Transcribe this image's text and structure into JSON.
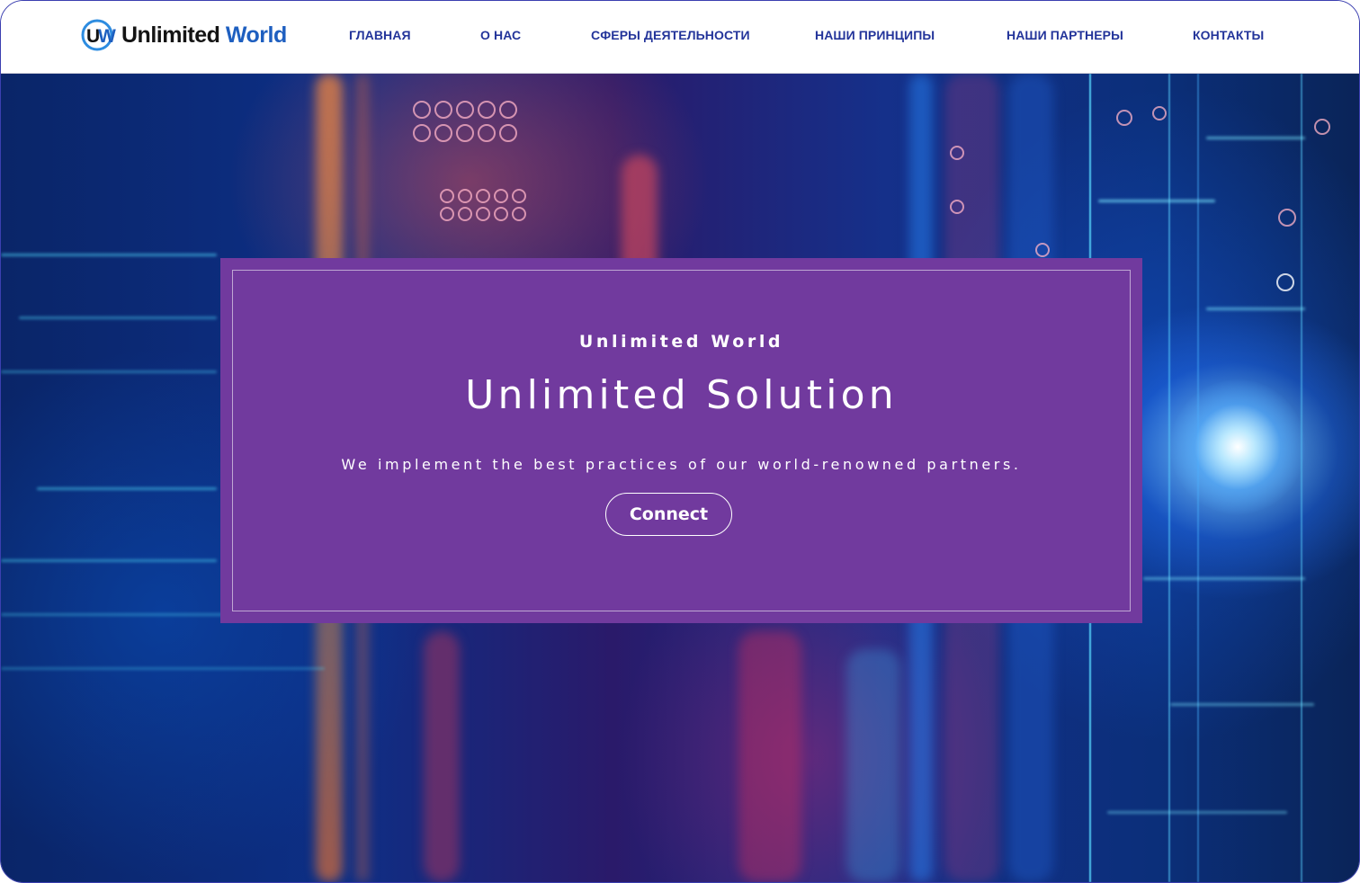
{
  "brand": {
    "mark": "UW",
    "name_part1": "Unlimited",
    "name_part2": "World",
    "colors": {
      "dark": "#141414",
      "blue": "#1e5fc0"
    }
  },
  "nav": {
    "items": [
      {
        "label": "ГЛАВНАЯ"
      },
      {
        "label": "О НАС"
      },
      {
        "label": "СФЕРЫ ДЕЯТЕЛЬНОСТИ"
      },
      {
        "label": "НАШИ ПРИНЦИПЫ"
      },
      {
        "label": "НАШИ ПАРТНЕРЫ"
      },
      {
        "label": "КОНТАКТЫ"
      }
    ],
    "color": "#23349a"
  },
  "hero": {
    "eyebrow": "Unlimited World",
    "title": "Unlimited Solution",
    "subtitle": "We implement the best practices of our world-renowned partners.",
    "cta_label": "Connect",
    "card_color": "#713a9e",
    "background_description_icon": "circuit-server-background"
  }
}
